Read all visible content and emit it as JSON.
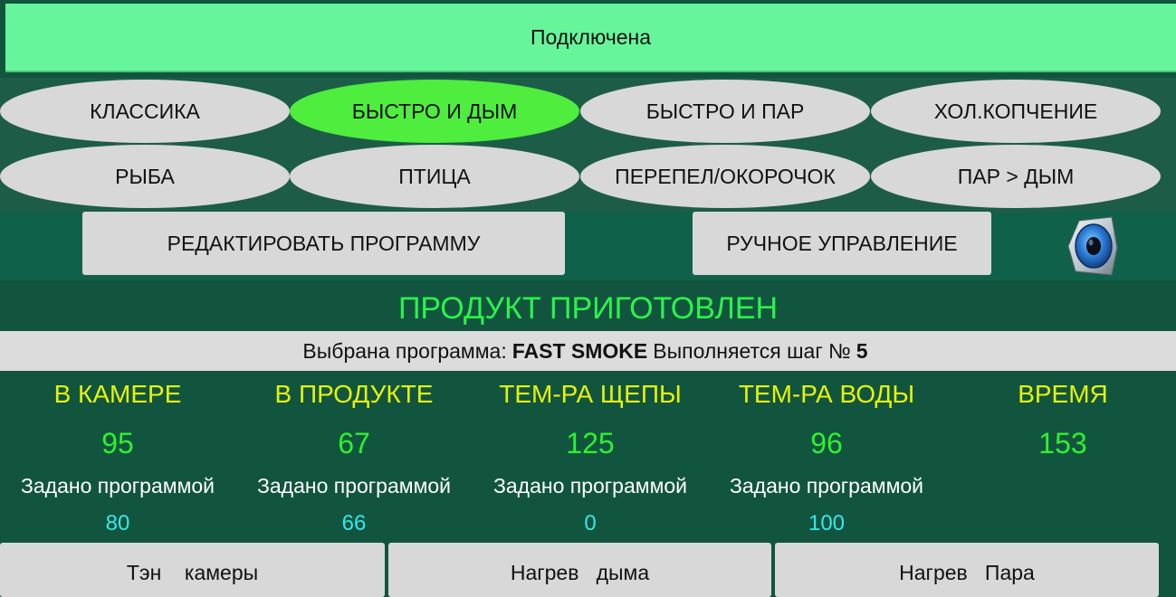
{
  "status": "Подключена",
  "programs": {
    "row1": [
      "КЛАССИКА",
      "БЫСТРО И ДЫМ",
      "БЫСТРО И ПАР",
      "ХОЛ.КОПЧЕНИЕ"
    ],
    "row2": [
      "РЫБА",
      "ПТИЦА",
      "ПЕРЕПЕЛ/ОКОРОЧОК",
      "ПАР > ДЫМ"
    ],
    "selected": "БЫСТРО И ДЫМ"
  },
  "actions": {
    "edit_label": "РЕДАКТИРОВАТЬ ПРОГРАММУ",
    "manual_label": "РУЧНОЕ УПРАВЛЕНИЕ",
    "sound_icon": "speaker-icon"
  },
  "message": "ПРОДУКТ ПРИГОТОВЛЕН",
  "program_line": {
    "prefix": "Выбрана программа:",
    "name": "FAST SMOKE",
    "step_prefix": "Выполняется шаг №",
    "step": "5"
  },
  "readings": [
    {
      "label": "В КАМЕРЕ",
      "value": "95",
      "set_label": "Задано программой",
      "set_value": "80"
    },
    {
      "label": "В ПРОДУКТЕ",
      "value": "67",
      "set_label": "Задано программой",
      "set_value": "66"
    },
    {
      "label": "ТЕМ-РА ЩЕПЫ",
      "value": "125",
      "set_label": "Задано программой",
      "set_value": "0"
    },
    {
      "label": "ТЕМ-РА ВОДЫ",
      "value": "96",
      "set_label": "Задано программой",
      "set_value": "100"
    },
    {
      "label": "ВРЕМЯ",
      "value": "153"
    }
  ],
  "controls": [
    "Тэн    камеры",
    "Нагрев   дыма",
    "Нагрев   Пара"
  ],
  "colors": {
    "background": "#12553f",
    "status_bg": "#66f59b",
    "selected_program": "#4eed3e",
    "message": "#2cf24a",
    "headers": "#e6f20c",
    "values": "#2ef12e",
    "set_values": "#39e6ea"
  }
}
